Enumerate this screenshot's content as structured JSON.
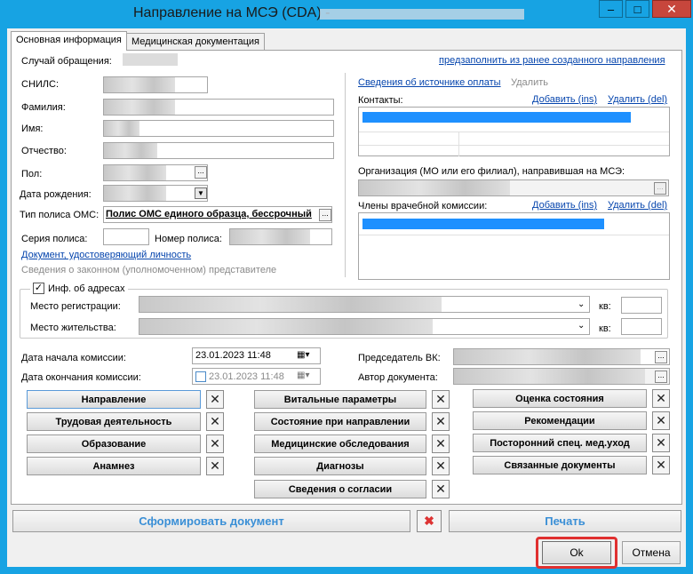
{
  "window": {
    "title": "Направление на МСЭ (CDA) -",
    "minimize": "–",
    "maximize": "□",
    "close": "✕"
  },
  "tabs": [
    {
      "label": "Основная информация"
    },
    {
      "label": "Медицинская документация"
    }
  ],
  "case": {
    "label": "Случай обращения:",
    "prefill_link": "предзаполнить из ранее созданного направления"
  },
  "fields": {
    "snils": "СНИЛС:",
    "surname": "Фамилия:",
    "name": "Имя:",
    "patronymic": "Отчество:",
    "gender": "Пол:",
    "birth_date": "Дата рождения:",
    "policy_type": "Тип полиса ОМС:",
    "policy_type_value": "Полис ОМС единого образца, бессрочный",
    "policy_series": "Серия полиса:",
    "policy_number": "Номер полиса:",
    "id_doc_link": "Документ, удостоверяющий личность",
    "legal_rep": "Сведения о законном (уполномоченном) представителе"
  },
  "right": {
    "payment_link": "Сведения об источнике оплаты",
    "payment_delete": "Удалить",
    "contacts": "Контакты:",
    "add_ins": "Добавить (ins)",
    "del_del": "Удалить (del)",
    "org_label": "Организация (МО или его филиал), направившая на МСЭ:",
    "commission": "Члены врачебной комиссии:"
  },
  "address": {
    "group_label": "Инф. об адресах",
    "checked": true,
    "registration": "Место регистрации:",
    "residence": "Место жительства:",
    "apt": "кв:"
  },
  "commission_dates": {
    "start_label": "Дата начала комиссии:",
    "start_value": "23.01.2023 11:48",
    "end_label": "Дата окончания комиссии:",
    "end_value": "23.01.2023 11:48",
    "chair_label": "Председатель ВК:",
    "author_label": "Автор документа:"
  },
  "section_buttons": {
    "col1": [
      "Направление",
      "Трудовая деятельность",
      "Образование",
      "Анамнез"
    ],
    "col2": [
      "Витальные параметры",
      "Состояние при направлении",
      "Медицинские обследования",
      "Диагнозы",
      "Сведения о согласии"
    ],
    "col3": [
      "Оценка состояния",
      "Рекомендации",
      "Посторонний спец. мед.уход",
      "Связанные документы"
    ]
  },
  "bottom": {
    "form_doc": "Сформировать документ",
    "print": "Печать",
    "ok": "Ok",
    "cancel": "Отмена"
  },
  "colors": {
    "title_bar": "#17a3e3",
    "highlight": "#e03030",
    "selection": "#1e90ff"
  }
}
